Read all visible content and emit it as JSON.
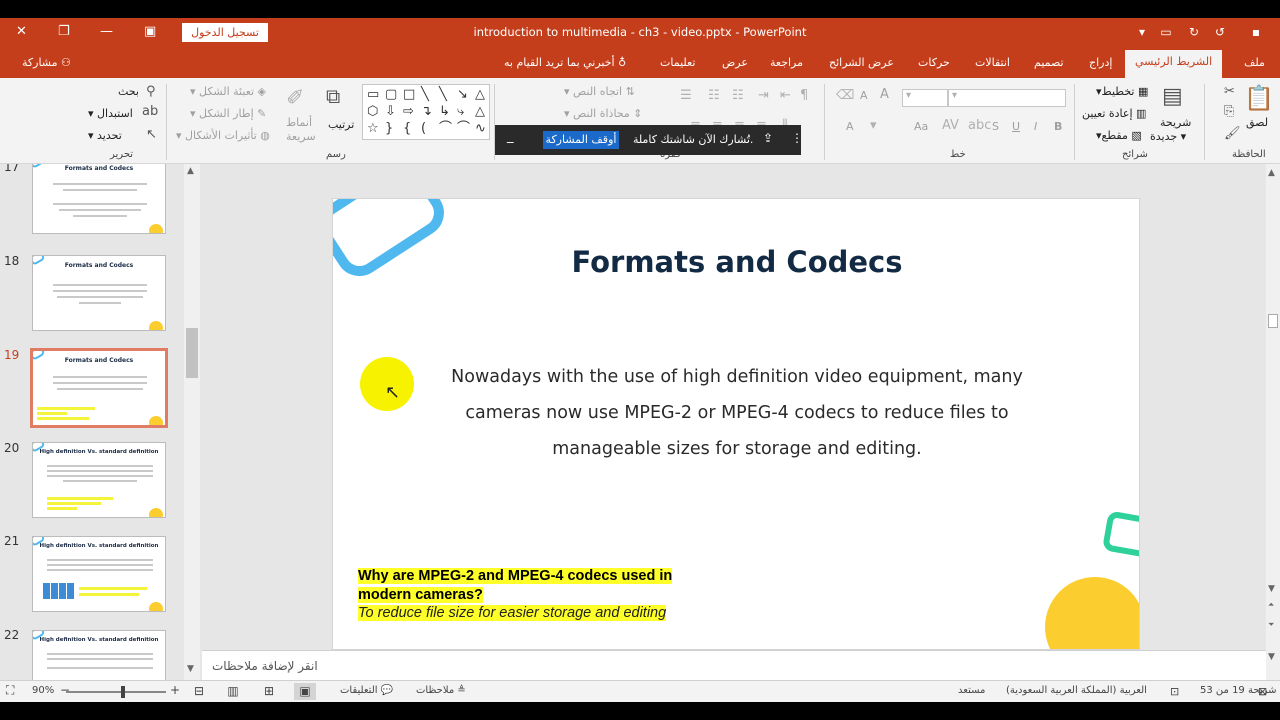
{
  "titlebar": {
    "doc_title": "introduction to multimedia - ch3 - video.pptx  -  PowerPoint",
    "login_button": "تسجيل الدخول"
  },
  "tabs": {
    "file": "ملف",
    "home": "الشريط الرئيسي",
    "insert": "إدراج",
    "design": "تصميم",
    "transitions": "انتقالات",
    "animations": "حركات",
    "slideshow": "عرض الشرائح",
    "review": "مراجعة",
    "view": "عرض",
    "help": "تعليمات",
    "tell_me": "أخبرني بما تريد القيام به",
    "share": "مشاركة"
  },
  "ribbon": {
    "clipboard": {
      "paste": "لصق",
      "group": "الحافظة"
    },
    "slides": {
      "new_slide_line1": "شريحة",
      "new_slide_line2": "جديدة",
      "layout": "تخطيط",
      "reset": "إعادة تعيين",
      "section": "مقطع",
      "group": "شرائح"
    },
    "font": {
      "group": "خط",
      "bold": "B",
      "italic": "I",
      "underline": "U",
      "strike": "S",
      "aa": "Aa",
      "grow": "A",
      "shrink": "A"
    },
    "paragraph": {
      "text_direction": "اتجاه النص",
      "align_text": "محاذاة النص",
      "group": "فقرة"
    },
    "drawing": {
      "arrange": "ترتيب",
      "quick_styles_line1": "أنماط",
      "quick_styles_line2": "سريعة",
      "shape_fill": "تعبئة الشكل",
      "shape_outline": "إطار الشكل",
      "shape_effects": "تأثيرات الأشكال",
      "group": "رسم"
    },
    "editing": {
      "find": "بحث",
      "replace": "استبدال",
      "select": "تحديد",
      "group": "تحرير"
    }
  },
  "sharing_bar": {
    "message": "تُشارك الآن شاشتك كاملة.",
    "stop_button": "أوقف المشاركة",
    "minimize": "_"
  },
  "thumbnails": [
    {
      "num": "17",
      "title": "Formats and Codecs",
      "selected": false
    },
    {
      "num": "18",
      "title": "Formats and Codecs",
      "selected": false
    },
    {
      "num": "19",
      "title": "Formats and Codecs",
      "selected": true
    },
    {
      "num": "20",
      "title": "High definition Vs. standard definition",
      "selected": false
    },
    {
      "num": "21",
      "title": "High definition Vs. standard definition",
      "selected": false
    },
    {
      "num": "22",
      "title": "High definition Vs. standard definition",
      "selected": false
    }
  ],
  "slide": {
    "title": "Formats and Codecs",
    "body": "Nowadays with the use of high definition video equipment, many cameras now use MPEG-2 or MPEG-4 codecs to reduce files to manageable sizes for storage and editing.",
    "question_line1": "Why are MPEG-2 and MPEG-4 codecs used in",
    "question_line2": "modern cameras?",
    "answer": "To reduce file size for easier storage and editing",
    "colors": {
      "title": "#132a45",
      "blue_deco": "#4fb8ef",
      "green_deco": "#2fd19a",
      "yellow_deco": "#fbcd2e",
      "highlight": "#ffff2a"
    }
  },
  "notes": {
    "placeholder": "انقر لإضافة ملاحظات"
  },
  "status": {
    "slide_info": "شريحة 19 من 53",
    "language": "العربية (المملكة العربية السعودية)",
    "accessibility": "مستعد",
    "notes": "ملاحظات",
    "comments": "التعليقات",
    "zoom": "90%",
    "zoom_minus": "−",
    "zoom_plus": "+"
  }
}
